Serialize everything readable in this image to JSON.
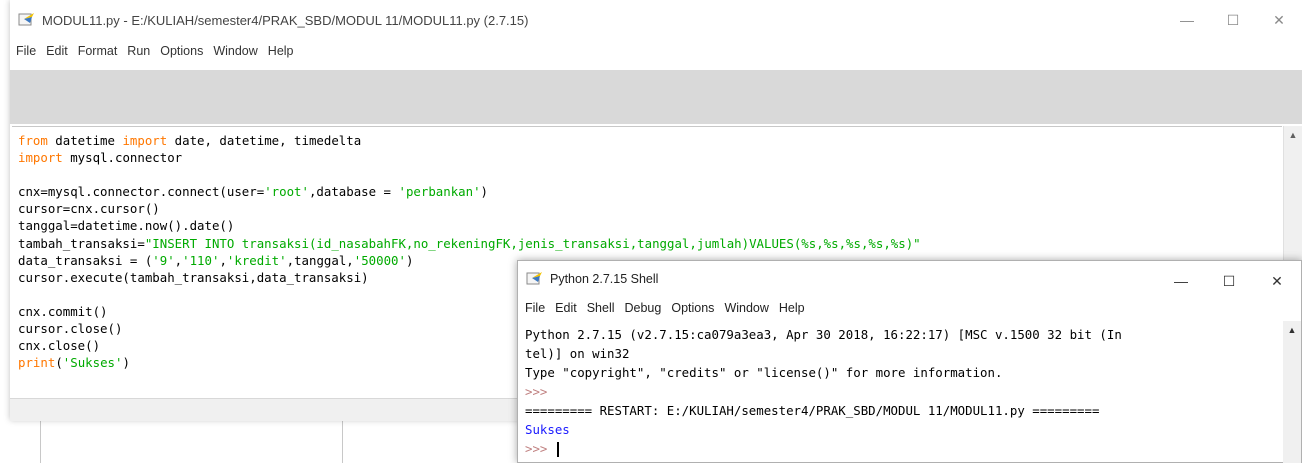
{
  "editor": {
    "title": "MODUL11.py - E:/KULIAH/semester4/PRAK_SBD/MODUL 11/MODUL11.py (2.7.15)",
    "menu": [
      "File",
      "Edit",
      "Format",
      "Run",
      "Options",
      "Window",
      "Help"
    ],
    "controls": {
      "minimize": "—",
      "maximize": "☐",
      "close": "✕"
    },
    "code": {
      "l1": {
        "kw1": "from",
        "t1": " datetime ",
        "kw2": "import",
        "t2": " date, datetime, timedelta"
      },
      "l2": {
        "kw": "import",
        "t": " mysql.connector"
      },
      "l4": {
        "t1": "cnx=mysql.connector.connect(user=",
        "s1": "'root'",
        "t2": ",database = ",
        "s2": "'perbankan'",
        "t3": ")"
      },
      "l5": "cursor=cnx.cursor()",
      "l6": "tanggal=datetime.now().date()",
      "l7": {
        "t": "tambah_transaksi=",
        "s": "\"INSERT INTO transaksi(id_nasabahFK,no_rekeningFK,jenis_transaksi,tanggal,jumlah)VALUES(%s,%s,%s,%s,%s)\""
      },
      "l8": {
        "t1": "data_transaksi = (",
        "s1": "'9'",
        "c1": ",",
        "s2": "'110'",
        "c2": ",",
        "s3": "'kredit'",
        "t2": ",tanggal,",
        "s4": "'50000'",
        "t3": ")"
      },
      "l9": "cursor.execute(tambah_transaksi,data_transaksi)",
      "l11": "cnx.commit()",
      "l12": "cursor.close()",
      "l13": "cnx.close()",
      "l14": {
        "kw": "print",
        "t1": "(",
        "s": "'Sukses'",
        "t2": ")"
      }
    }
  },
  "shell": {
    "title": "Python 2.7.15 Shell",
    "menu": [
      "File",
      "Edit",
      "Shell",
      "Debug",
      "Options",
      "Window",
      "Help"
    ],
    "controls": {
      "minimize": "—",
      "maximize": "☐",
      "close": "✕"
    },
    "lines": {
      "l1": "Python 2.7.15 (v2.7.15:ca079a3ea3, Apr 30 2018, 16:22:17) [MSC v.1500 32 bit (In",
      "l2": "tel)] on win32",
      "l3": "Type \"copyright\", \"credits\" or \"license()\" for more information.",
      "prompt": ">>>",
      "restart": "========= RESTART: E:/KULIAH/semester4/PRAK_SBD/MODUL 11/MODUL11.py =========",
      "output": "Sukses"
    }
  },
  "icons": {
    "app": "python-idle-icon",
    "scroll_up": "scroll-up-arrow-icon"
  },
  "colors": {
    "keyword": "#ff7700",
    "string": "#00aa00",
    "output": "#1a1aff",
    "prompt": "#c08080",
    "toolarea": "#d9d9d9"
  }
}
